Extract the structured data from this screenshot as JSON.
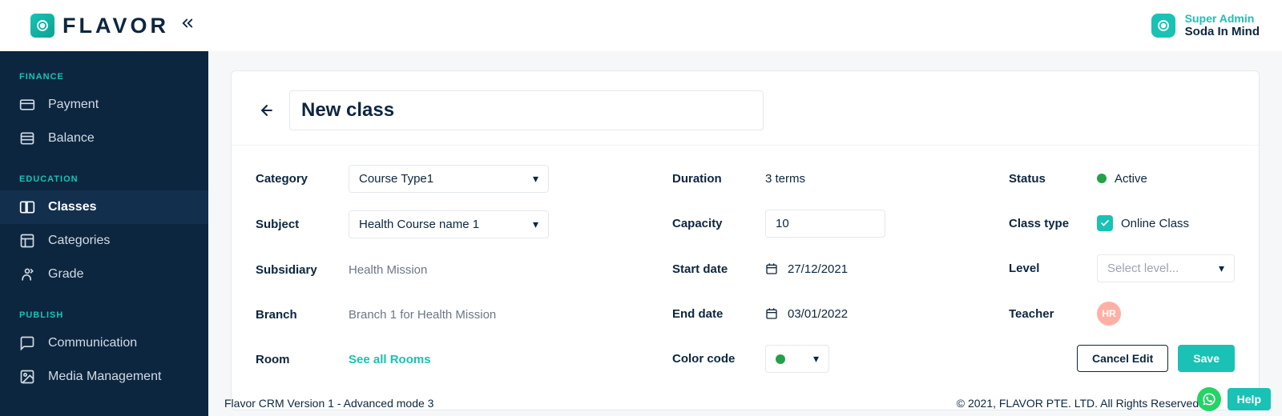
{
  "brand": {
    "name": "FLAVOR"
  },
  "user": {
    "role": "Super Admin",
    "company": "Soda In Mind"
  },
  "sidebar": {
    "groups": [
      {
        "title": "FINANCE",
        "items": [
          {
            "label": "Payment"
          },
          {
            "label": "Balance"
          }
        ]
      },
      {
        "title": "EDUCATION",
        "items": [
          {
            "label": "Classes"
          },
          {
            "label": "Categories"
          },
          {
            "label": "Grade"
          }
        ]
      },
      {
        "title": "PUBLISH",
        "items": [
          {
            "label": "Communication"
          },
          {
            "label": "Media Management"
          }
        ]
      }
    ]
  },
  "page": {
    "title": "New class",
    "labels": {
      "category": "Category",
      "subject": "Subject",
      "subsidiary": "Subsidiary",
      "branch": "Branch",
      "room": "Room",
      "duration": "Duration",
      "capacity": "Capacity",
      "start_date": "Start date",
      "end_date": "End date",
      "color_code": "Color code",
      "status": "Status",
      "class_type": "Class type",
      "level": "Level",
      "teacher": "Teacher"
    },
    "values": {
      "category": "Course Type1",
      "subject": "Health Course name 1",
      "subsidiary": "Health Mission",
      "branch": "Branch 1 for Health Mission",
      "room_link": "See all Rooms",
      "duration": "3 terms",
      "capacity": "10",
      "start_date": "27/12/2021",
      "end_date": "03/01/2022",
      "color_code": "#24a148",
      "status": "Active",
      "class_type": "Online Class",
      "level_placeholder": "Select level...",
      "teacher_initials": "HR"
    },
    "buttons": {
      "cancel": "Cancel Edit",
      "save": "Save",
      "help": "Help"
    }
  },
  "footer": {
    "version": "Flavor CRM Version 1 - Advanced mode 3",
    "copyright": "© 2021, FLAVOR PTE. LTD. All Rights Reserved."
  }
}
